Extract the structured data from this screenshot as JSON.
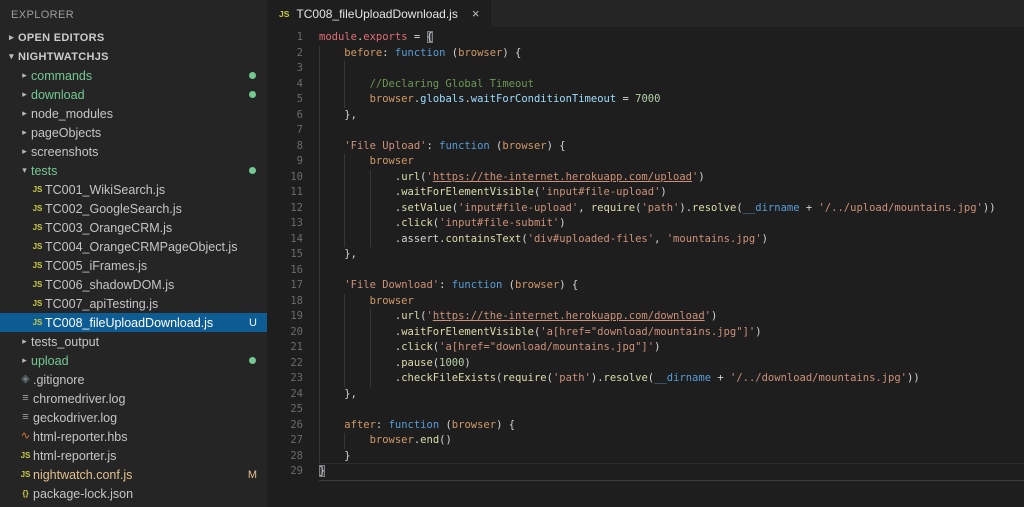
{
  "colors": {
    "syntax": {
      "red": "#e06c75",
      "orange": "#d19a66",
      "blue": "#569cd6",
      "yellow": "#dcdcaa",
      "string": "#ce9178",
      "comment": "#6a9955",
      "number": "#b5cea8",
      "prop": "#9cdcfe",
      "fg": "#d4d4d4"
    },
    "ui": {
      "treeFg": "#c5c5c5",
      "untracked": "#73c991",
      "modified": "#e2c08d",
      "selectedFg": "#ffffff",
      "selectionBg": "#0d5c93"
    }
  },
  "sidebar": {
    "header": "EXPLORER",
    "tree": [
      {
        "kind": "section",
        "label": "OPEN EDITORS",
        "twisty": "collapsed",
        "indent": 0
      },
      {
        "kind": "section",
        "label": "NIGHTWATCHJS",
        "twisty": "expanded",
        "indent": 0
      },
      {
        "kind": "folder",
        "label": "commands",
        "twisty": "collapsed",
        "indent": 1,
        "color": "untracked",
        "badge": "dot"
      },
      {
        "kind": "folder",
        "label": "download",
        "twisty": "collapsed",
        "indent": 1,
        "color": "untracked",
        "badge": "dot"
      },
      {
        "kind": "folder",
        "label": "node_modules",
        "twisty": "collapsed",
        "indent": 1
      },
      {
        "kind": "folder",
        "label": "pageObjects",
        "twisty": "collapsed",
        "indent": 1
      },
      {
        "kind": "folder",
        "label": "screenshots",
        "twisty": "collapsed",
        "indent": 1
      },
      {
        "kind": "folder",
        "label": "tests",
        "twisty": "expanded",
        "indent": 1,
        "color": "untracked",
        "badge": "dot"
      },
      {
        "kind": "file",
        "label": "TC001_WikiSearch.js",
        "icon": "js",
        "indent": 2
      },
      {
        "kind": "file",
        "label": "TC002_GoogleSearch.js",
        "icon": "js",
        "indent": 2
      },
      {
        "kind": "file",
        "label": "TC003_OrangeCRM.js",
        "icon": "js",
        "indent": 2
      },
      {
        "kind": "file",
        "label": "TC004_OrangeCRMPageObject.js",
        "icon": "js",
        "indent": 2
      },
      {
        "kind": "file",
        "label": "TC005_iFrames.js",
        "icon": "js",
        "indent": 2
      },
      {
        "kind": "file",
        "label": "TC006_shadowDOM.js",
        "icon": "js",
        "indent": 2
      },
      {
        "kind": "file",
        "label": "TC007_apiTesting.js",
        "icon": "js",
        "indent": 2
      },
      {
        "kind": "file",
        "label": "TC008_fileUploadDownload.js",
        "icon": "js",
        "indent": 2,
        "selected": true,
        "badge": "U"
      },
      {
        "kind": "folder",
        "label": "tests_output",
        "twisty": "collapsed",
        "indent": 1
      },
      {
        "kind": "folder",
        "label": "upload",
        "twisty": "collapsed",
        "indent": 1,
        "color": "untracked",
        "badge": "dot"
      },
      {
        "kind": "file",
        "label": ".gitignore",
        "icon": "git",
        "indent": 1
      },
      {
        "kind": "file",
        "label": "chromedriver.log",
        "icon": "log",
        "indent": 1
      },
      {
        "kind": "file",
        "label": "geckodriver.log",
        "icon": "log",
        "indent": 1
      },
      {
        "kind": "file",
        "label": "html-reporter.hbs",
        "icon": "hbs",
        "indent": 1
      },
      {
        "kind": "file",
        "label": "html-reporter.js",
        "icon": "js",
        "indent": 1
      },
      {
        "kind": "file",
        "label": "nightwatch.conf.js",
        "icon": "js",
        "indent": 1,
        "color": "modified",
        "badge": "M"
      },
      {
        "kind": "file",
        "label": "package-lock.json",
        "icon": "json",
        "indent": 1
      }
    ]
  },
  "editor": {
    "tab": {
      "icon_label": "JS",
      "title": "TC008_fileUploadDownload.js",
      "close": "×"
    },
    "code": {
      "lines": [
        {
          "n": 1,
          "g": 0,
          "t": [
            [
              "module",
              "red"
            ],
            [
              ".",
              "fg"
            ],
            [
              "exports",
              "red"
            ],
            [
              " = ",
              "fg"
            ],
            [
              "{",
              "fg",
              "box"
            ]
          ]
        },
        {
          "n": 2,
          "g": 1,
          "t": [
            [
              "    ",
              "fg"
            ],
            [
              "before",
              "orange"
            ],
            [
              ": ",
              "fg"
            ],
            [
              "function",
              "blue"
            ],
            [
              " (",
              "fg"
            ],
            [
              "browser",
              "orange"
            ],
            [
              ") {",
              "fg"
            ]
          ]
        },
        {
          "n": 3,
          "g": 2,
          "t": []
        },
        {
          "n": 4,
          "g": 2,
          "t": [
            [
              "        //Declaring Global Timeout",
              "comment"
            ]
          ]
        },
        {
          "n": 5,
          "g": 2,
          "t": [
            [
              "        ",
              "fg"
            ],
            [
              "browser",
              "orange"
            ],
            [
              ".",
              "fg"
            ],
            [
              "globals",
              "prop"
            ],
            [
              ".",
              "fg"
            ],
            [
              "waitForConditionTimeout",
              "prop"
            ],
            [
              " = ",
              "fg"
            ],
            [
              "7000",
              "number"
            ]
          ]
        },
        {
          "n": 6,
          "g": 1,
          "t": [
            [
              "    },",
              "fg"
            ]
          ]
        },
        {
          "n": 7,
          "g": 1,
          "t": []
        },
        {
          "n": 8,
          "g": 1,
          "t": [
            [
              "    ",
              "fg"
            ],
            [
              "'File Upload'",
              "string"
            ],
            [
              ": ",
              "fg"
            ],
            [
              "function",
              "blue"
            ],
            [
              " (",
              "fg"
            ],
            [
              "browser",
              "orange"
            ],
            [
              ") {",
              "fg"
            ]
          ]
        },
        {
          "n": 9,
          "g": 2,
          "t": [
            [
              "        ",
              "fg"
            ],
            [
              "browser",
              "orange"
            ]
          ]
        },
        {
          "n": 10,
          "g": 3,
          "t": [
            [
              "            .",
              "fg"
            ],
            [
              "url",
              "yellow"
            ],
            [
              "(",
              "fg"
            ],
            [
              "'",
              "string"
            ],
            [
              "https://the-internet.herokuapp.com/upload",
              "string",
              "u"
            ],
            [
              "'",
              "string"
            ],
            [
              ")",
              "fg"
            ]
          ]
        },
        {
          "n": 11,
          "g": 3,
          "t": [
            [
              "            .",
              "fg"
            ],
            [
              "waitForElementVisible",
              "yellow"
            ],
            [
              "(",
              "fg"
            ],
            [
              "'input#file-upload'",
              "string"
            ],
            [
              ")",
              "fg"
            ]
          ]
        },
        {
          "n": 12,
          "g": 3,
          "t": [
            [
              "            .",
              "fg"
            ],
            [
              "setValue",
              "yellow"
            ],
            [
              "(",
              "fg"
            ],
            [
              "'input#file-upload'",
              "string"
            ],
            [
              ", ",
              "fg"
            ],
            [
              "require",
              "yellow"
            ],
            [
              "(",
              "fg"
            ],
            [
              "'path'",
              "string"
            ],
            [
              ").",
              "fg"
            ],
            [
              "resolve",
              "yellow"
            ],
            [
              "(",
              "fg"
            ],
            [
              "__dirname",
              "blue"
            ],
            [
              " + ",
              "fg"
            ],
            [
              "'/../upload/mountains.jpg'",
              "string"
            ],
            [
              "))",
              "fg"
            ]
          ]
        },
        {
          "n": 13,
          "g": 3,
          "t": [
            [
              "            .",
              "fg"
            ],
            [
              "click",
              "yellow"
            ],
            [
              "(",
              "fg"
            ],
            [
              "'input#file-submit'",
              "string"
            ],
            [
              ")",
              "fg"
            ]
          ]
        },
        {
          "n": 14,
          "g": 3,
          "t": [
            [
              "            .",
              "fg"
            ],
            [
              "assert",
              "fg"
            ],
            [
              ".",
              "fg"
            ],
            [
              "containsText",
              "yellow"
            ],
            [
              "(",
              "fg"
            ],
            [
              "'div#uploaded-files'",
              "string"
            ],
            [
              ", ",
              "fg"
            ],
            [
              "'mountains.jpg'",
              "string"
            ],
            [
              ")",
              "fg"
            ]
          ]
        },
        {
          "n": 15,
          "g": 1,
          "t": [
            [
              "    },",
              "fg"
            ]
          ]
        },
        {
          "n": 16,
          "g": 1,
          "t": []
        },
        {
          "n": 17,
          "g": 1,
          "t": [
            [
              "    ",
              "fg"
            ],
            [
              "'File Download'",
              "string"
            ],
            [
              ": ",
              "fg"
            ],
            [
              "function",
              "blue"
            ],
            [
              " (",
              "fg"
            ],
            [
              "browser",
              "orange"
            ],
            [
              ") {",
              "fg"
            ]
          ]
        },
        {
          "n": 18,
          "g": 2,
          "t": [
            [
              "        ",
              "fg"
            ],
            [
              "browser",
              "orange"
            ]
          ]
        },
        {
          "n": 19,
          "g": 3,
          "t": [
            [
              "            .",
              "fg"
            ],
            [
              "url",
              "yellow"
            ],
            [
              "(",
              "fg"
            ],
            [
              "'",
              "string"
            ],
            [
              "https://the-internet.herokuapp.com/download",
              "string",
              "u"
            ],
            [
              "'",
              "string"
            ],
            [
              ")",
              "fg"
            ]
          ]
        },
        {
          "n": 20,
          "g": 3,
          "t": [
            [
              "            .",
              "fg"
            ],
            [
              "waitForElementVisible",
              "yellow"
            ],
            [
              "(",
              "fg"
            ],
            [
              "'a[href=\"download/mountains.jpg\"]'",
              "string"
            ],
            [
              ")",
              "fg"
            ]
          ]
        },
        {
          "n": 21,
          "g": 3,
          "t": [
            [
              "            .",
              "fg"
            ],
            [
              "click",
              "yellow"
            ],
            [
              "(",
              "fg"
            ],
            [
              "'a[href=\"download/mountains.jpg\"]'",
              "string"
            ],
            [
              ")",
              "fg"
            ]
          ]
        },
        {
          "n": 22,
          "g": 3,
          "t": [
            [
              "            .",
              "fg"
            ],
            [
              "pause",
              "yellow"
            ],
            [
              "(",
              "fg"
            ],
            [
              "1000",
              "number"
            ],
            [
              ")",
              "fg"
            ]
          ]
        },
        {
          "n": 23,
          "g": 3,
          "t": [
            [
              "            .",
              "fg"
            ],
            [
              "checkFileExists",
              "yellow"
            ],
            [
              "(",
              "fg"
            ],
            [
              "require",
              "yellow"
            ],
            [
              "(",
              "fg"
            ],
            [
              "'path'",
              "string"
            ],
            [
              ").",
              "fg"
            ],
            [
              "resolve",
              "yellow"
            ],
            [
              "(",
              "fg"
            ],
            [
              "__dirname",
              "blue"
            ],
            [
              " + ",
              "fg"
            ],
            [
              "'/../download/mountains.jpg'",
              "string"
            ],
            [
              "))",
              "fg"
            ]
          ]
        },
        {
          "n": 24,
          "g": 1,
          "t": [
            [
              "    },",
              "fg"
            ]
          ]
        },
        {
          "n": 25,
          "g": 1,
          "t": []
        },
        {
          "n": 26,
          "g": 1,
          "t": [
            [
              "    ",
              "fg"
            ],
            [
              "after",
              "orange"
            ],
            [
              ": ",
              "fg"
            ],
            [
              "function",
              "blue"
            ],
            [
              " (",
              "fg"
            ],
            [
              "browser",
              "orange"
            ],
            [
              ") {",
              "fg"
            ]
          ]
        },
        {
          "n": 27,
          "g": 2,
          "t": [
            [
              "        ",
              "fg"
            ],
            [
              "browser",
              "orange"
            ],
            [
              ".",
              "fg"
            ],
            [
              "end",
              "yellow"
            ],
            [
              "()",
              "fg"
            ]
          ]
        },
        {
          "n": 28,
          "g": 1,
          "t": [
            [
              "    }",
              "fg"
            ]
          ]
        },
        {
          "n": 29,
          "g": 0,
          "cur": true,
          "t": [
            [
              "}",
              "fg",
              "box"
            ]
          ]
        }
      ]
    }
  }
}
